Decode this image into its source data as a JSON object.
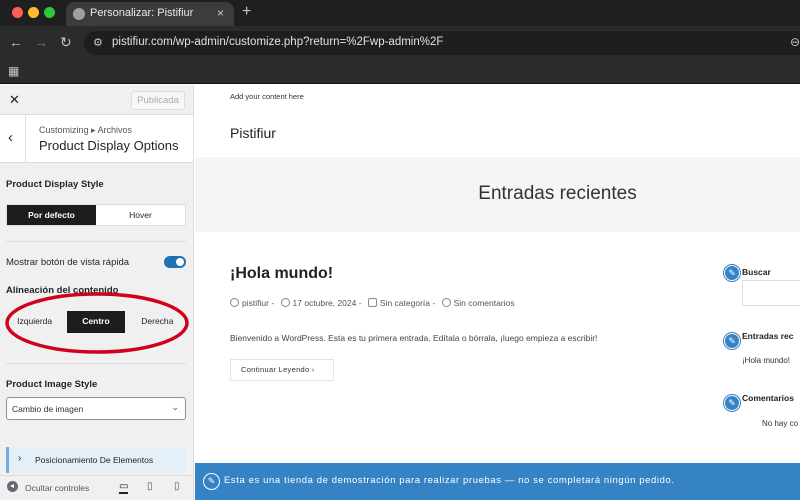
{
  "browser": {
    "tab_title": "Personalizar: Pistifiur",
    "tab_close": "×",
    "new_tab": "+",
    "url": "pistifiur.com/wp-admin/customize.php?return=%2Fwp-admin%2F",
    "icons": [
      "favicon-globe-icon",
      "back-arrow-icon",
      "forward-arrow-icon",
      "reload-icon",
      "site-settings-icon",
      "zoom-icon",
      "apps-grid-icon"
    ]
  },
  "customizer": {
    "close": "✕",
    "publish_label": "Publicada",
    "breadcrumb": "Customizing ▸ Archivos",
    "section_title": "Product Display Options",
    "display_style": {
      "label": "Product Display Style",
      "options": [
        "Por defecto",
        "Hover"
      ],
      "selected": "Por defecto"
    },
    "quick_view": {
      "label": "Mostrar botón de vista rápida",
      "enabled": true
    },
    "alignment": {
      "label": "Alineación del contenido",
      "options": [
        "Izquierda",
        "Centro",
        "Derecha"
      ],
      "selected": "Centro"
    },
    "image_style": {
      "label": "Product Image Style",
      "value": "Cambio de imagen"
    },
    "positioning": {
      "label": "Posicionamiento De Elementos"
    },
    "footer": {
      "hide_controls": "Ocultar controles",
      "devices": [
        "desktop-icon",
        "tablet-icon",
        "mobile-icon"
      ],
      "active_device": "desktop"
    },
    "accent_color": "#2271b1",
    "annotation_color": "#d0021b"
  },
  "preview": {
    "topbar_text": "Add your content here",
    "site_title": "Pistifiur",
    "hero_title": "Entradas recientes",
    "post": {
      "title": "¡Hola mundo!",
      "author": "pistifiur",
      "date": "17 octubre, 2024",
      "category": "Sin categoría",
      "comments": "Sin comentarios",
      "excerpt": "Bienvenido a WordPress. Esta es tu primera entrada. Edítala o bórrala, ¡luego empieza a escribir!",
      "read_more": "Continuar Leyendo"
    },
    "widgets": {
      "search_title": "Buscar",
      "recent_title": "Entradas rec",
      "recent_item": "¡Hola mundo!",
      "comments_title": "Comentarios",
      "comments_text": "No hay co"
    },
    "demo_notice": "Esta es una tienda de demostración para realizar pruebas — no se completará ningún pedido.",
    "demo_color": "#3582c4"
  }
}
